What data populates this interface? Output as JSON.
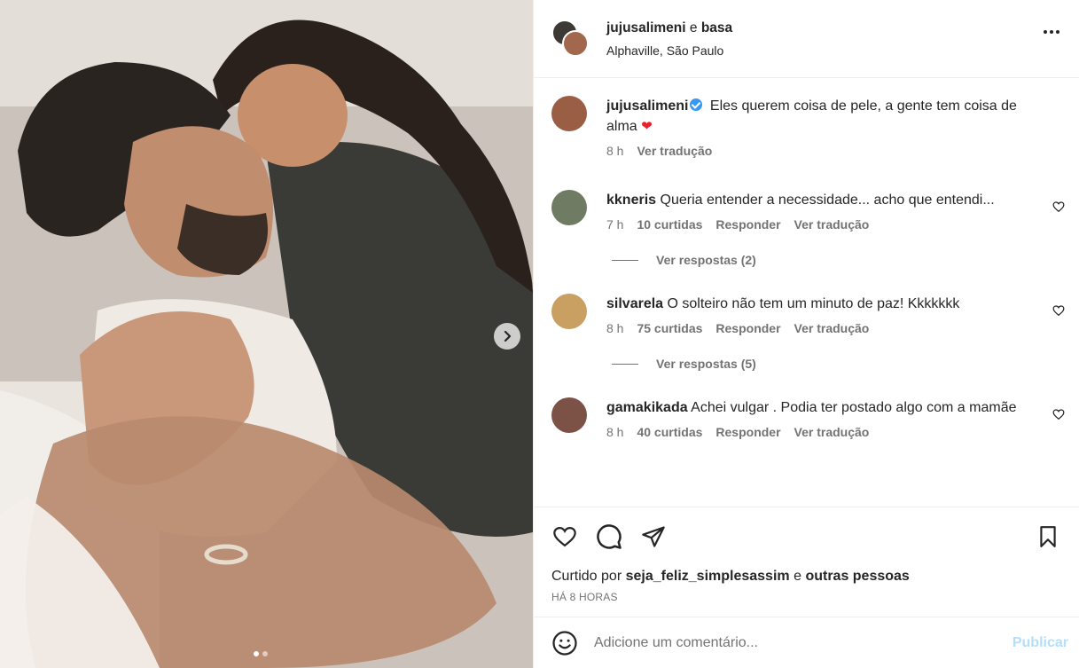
{
  "header": {
    "user1": "jujusalimeni",
    "joiner": "e",
    "user2": "basa",
    "location": "Alphaville, São Paulo",
    "more_icon": "more-horizontal-icon"
  },
  "caption": {
    "user": "jujusalimeni",
    "verified": true,
    "text": "Eles querem coisa de pele, a gente tem coisa de alma",
    "emoji": "❤",
    "time": "8 h",
    "translate": "Ver tradução"
  },
  "comments": [
    {
      "user": "kkneris",
      "text": "Queria entender a necessidade... acho que entendi...",
      "time": "7 h",
      "likes": "10 curtidas",
      "reply": "Responder",
      "translate": "Ver tradução",
      "view_replies": "Ver respostas (2)",
      "avatar_color": "#6f7b63"
    },
    {
      "user": "silvarela",
      "text": "O solteiro não tem um minuto de paz! Kkkkkkk",
      "time": "8 h",
      "likes": "75 curtidas",
      "reply": "Responder",
      "translate": "Ver tradução",
      "view_replies": "Ver respostas (5)",
      "avatar_color": "#c9a062"
    },
    {
      "user": "gamakikada",
      "text": "Achei vulgar . Podia ter postado algo com a mamãe",
      "time": "8 h",
      "likes": "40 curtidas",
      "reply": "Responder",
      "translate": "Ver tradução",
      "avatar_color": "#7d5246"
    }
  ],
  "likes": {
    "prefix": "Curtido por",
    "user": "seja_feliz_simplesassim",
    "joiner": "e",
    "others": "outras pessoas",
    "time": "HÁ 8 HORAS"
  },
  "add_comment": {
    "placeholder": "Adicione um comentário...",
    "publish": "Publicar"
  },
  "colors": {
    "accent": "#0095f6",
    "publish_disabled": "#b2dffc",
    "verified": "#3897f0",
    "heart": "#e8202d"
  },
  "carousel": {
    "current": 1,
    "total": 2
  }
}
